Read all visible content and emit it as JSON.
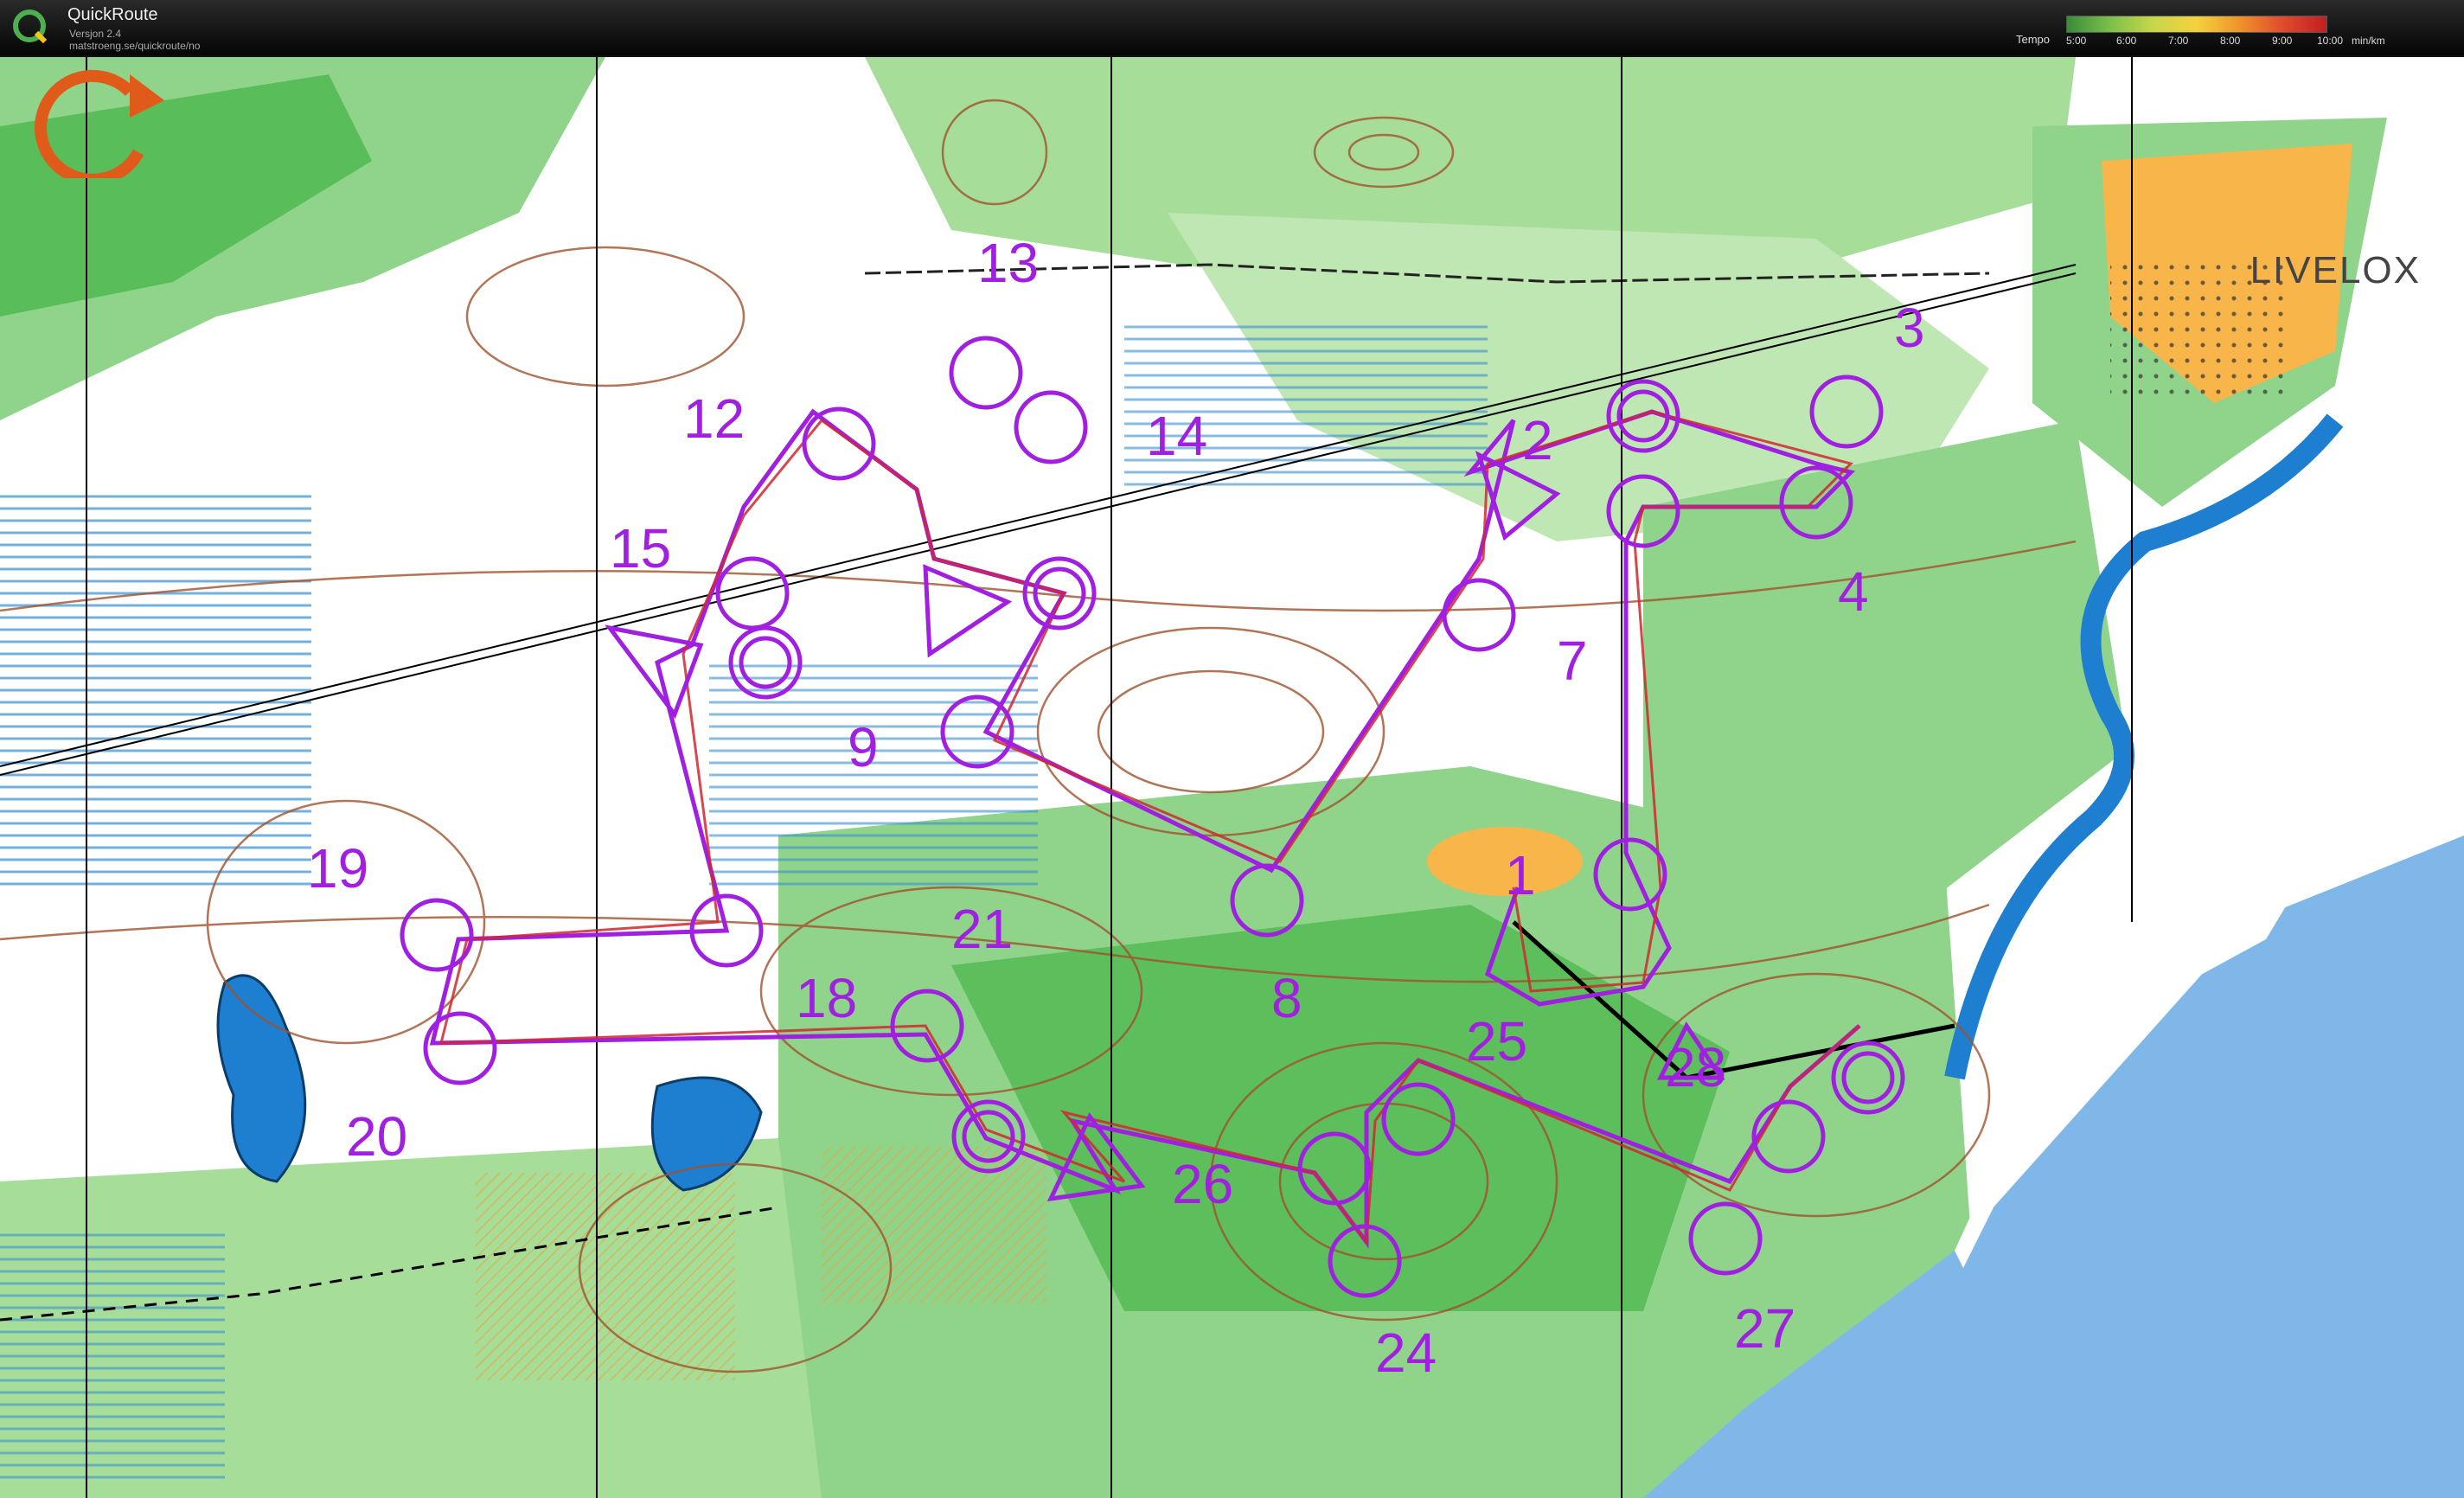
{
  "app": {
    "title": "QuickRoute",
    "version": "Versjon 2.4",
    "url": "matstroeng.se/quickroute/no",
    "icon": "quickroute-q-icon"
  },
  "tempo": {
    "label": "Tempo",
    "ticks": [
      "5:00",
      "6:00",
      "7:00",
      "8:00",
      "9:00",
      "10:00"
    ],
    "unit": "min/km",
    "colors": [
      "#3a8a3a",
      "#7cc04a",
      "#c8d64a",
      "#f4d23c",
      "#f0922c",
      "#e04a2c",
      "#c02020"
    ]
  },
  "watermark": {
    "text": "LIVELOX",
    "icon": "livelox-logo-icon"
  },
  "course": {
    "color": "#a01fe0",
    "route_color": "#d0282f",
    "control_labels": [
      "1",
      "2",
      "3",
      "4",
      "7",
      "8",
      "9",
      "12",
      "13",
      "14",
      "15",
      "18",
      "19",
      "20",
      "21",
      "24",
      "25",
      "26",
      "27",
      "28"
    ]
  },
  "map_colors": {
    "open_land": "#f7b54a",
    "forest_green": "#8fd48a",
    "dark_green": "#47b548",
    "water": "#1e7fd0",
    "contour": "#a0522d"
  }
}
